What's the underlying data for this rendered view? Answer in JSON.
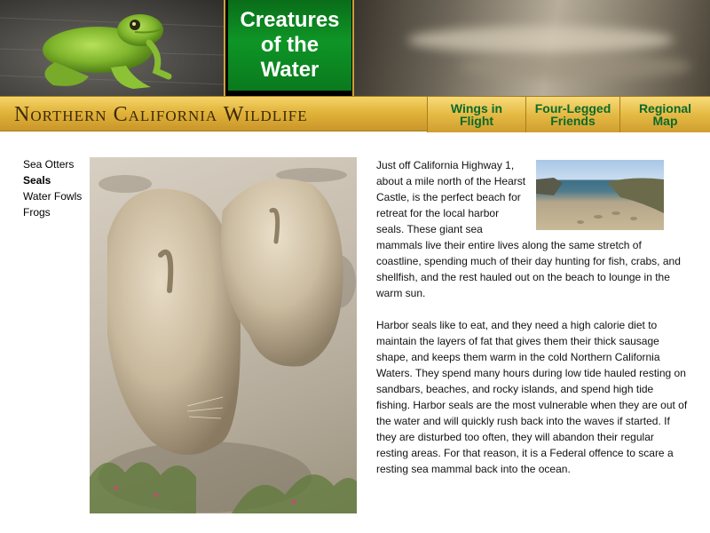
{
  "header": {
    "title": "Creatures\nof the\nWater",
    "banner": "Northern California Wildlife"
  },
  "nav": {
    "items": [
      {
        "label": "Wings in\nFlight"
      },
      {
        "label": "Four-Legged\nFriends"
      },
      {
        "label": "Regional\nMap"
      }
    ]
  },
  "sidebar": {
    "items": [
      {
        "label": "Sea Otters",
        "active": false
      },
      {
        "label": "Seals",
        "active": true
      },
      {
        "label": "Water Fowls",
        "active": false
      },
      {
        "label": "Frogs",
        "active": false
      }
    ]
  },
  "article": {
    "paragraphs": [
      "Just off California Highway 1, about a mile north of the Hearst Castle, is the perfect beach for retreat for the local harbor seals. These giant sea mammals live their entire lives along the same stretch of coastline, spending much of their day hunting for fish, crabs, and shellfish, and the rest hauled out on the beach to lounge in the warm sun.",
      "Harbor seals like to eat, and they need a high calorie diet to maintain the layers of fat that gives them their thick sausage shape, and keeps them warm in the cold Northern California Waters. They spend many hours during low tide hauled resting on sandbars, beaches, and rocky islands, and spend high tide fishing. Harbor seals are the most vulnerable when they are out of the water and will quickly rush back into the waves if started. If they are disturbed too often, they will abandon their regular resting areas. For that reason, it is a Federal offence to scare a resting sea mammal back into the ocean."
    ]
  },
  "colors": {
    "title_green": "#0e9526",
    "nav_text": "#0b6a2a",
    "gold": "#e2b43a",
    "banner_text": "#3b2a0b"
  }
}
